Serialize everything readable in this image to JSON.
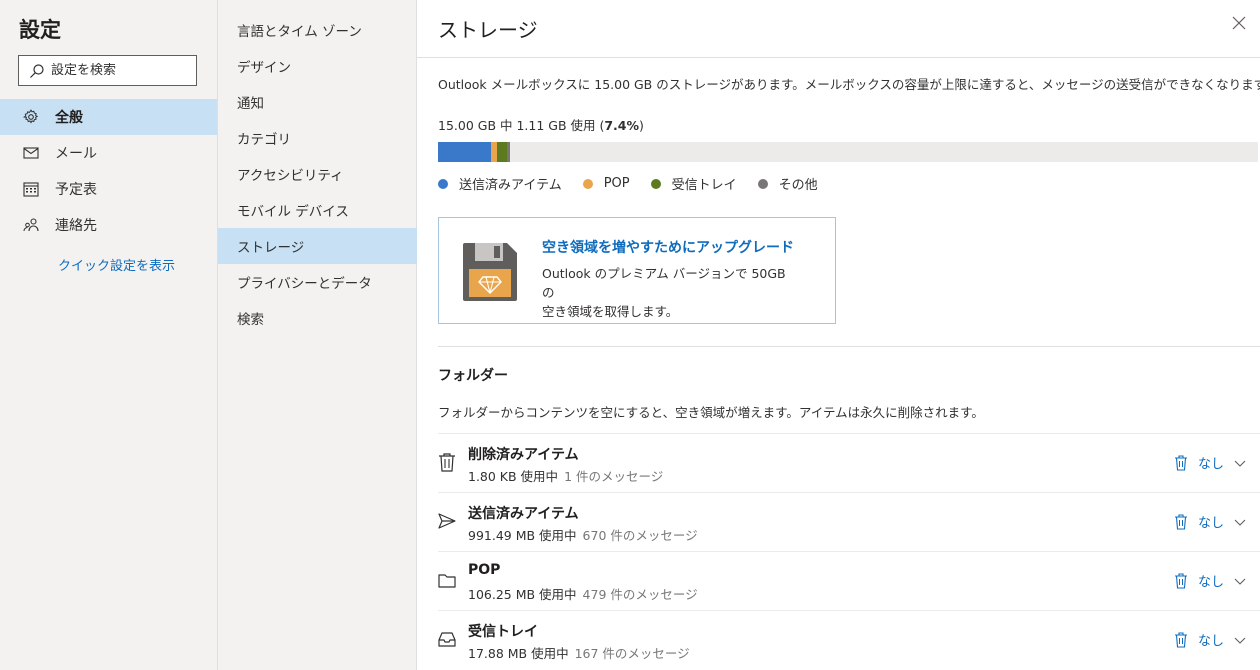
{
  "settings": {
    "title": "設定",
    "search_placeholder": "設定を検索",
    "nav": [
      {
        "label": "全般",
        "icon": "gear-icon",
        "selected": true
      },
      {
        "label": "メール",
        "icon": "mail-icon",
        "selected": false
      },
      {
        "label": "予定表",
        "icon": "calendar-icon",
        "selected": false
      },
      {
        "label": "連絡先",
        "icon": "people-icon",
        "selected": false
      }
    ],
    "quick_settings": "クイック設定を表示"
  },
  "subnav": [
    {
      "label": "言語とタイム ゾーン",
      "selected": false
    },
    {
      "label": "デザイン",
      "selected": false
    },
    {
      "label": "通知",
      "selected": false
    },
    {
      "label": "カテゴリ",
      "selected": false
    },
    {
      "label": "アクセシビリティ",
      "selected": false
    },
    {
      "label": "モバイル デバイス",
      "selected": false
    },
    {
      "label": "ストレージ",
      "selected": true
    },
    {
      "label": "プライバシーとデータ",
      "selected": false
    },
    {
      "label": "検索",
      "selected": false
    }
  ],
  "storage": {
    "title": "ストレージ",
    "description": "Outlook メールボックスに 15.00 GB のストレージがあります。メールボックスの容量が上限に達すると、メッセージの送受信ができなくなります。",
    "usage_text": "15.00 GB 中 1.11 GB 使用 (",
    "usage_percent": "7.4%",
    "usage_close": ")",
    "segments": [
      {
        "name": "送信済みアイテム",
        "color": "#3a78c9",
        "fraction": 0.0645
      },
      {
        "name": "POP",
        "color": "#e8a54b",
        "fraction": 0.0069
      },
      {
        "name": "受信トレイ",
        "color": "#5c7a1f",
        "fraction": 0.0116
      },
      {
        "name": "その他",
        "color": "#797775",
        "fraction": 0.004
      }
    ],
    "upgrade": {
      "title": "空き領域を増やすためにアップグレード",
      "line1": "Outlook のプレミアム バージョンで 50GB の",
      "line2": "空き領域を取得します。"
    }
  },
  "folders": {
    "title": "フォルダー",
    "description": "フォルダーからコンテンツを空にすると、空き領域が増えます。アイテムは永久に削除されます。",
    "items": [
      {
        "name": "削除済みアイテム",
        "size": "1.80 KB 使用中",
        "count": "1 件のメッセージ",
        "action": "なし",
        "icon": "trash"
      },
      {
        "name": "送信済みアイテム",
        "size": "991.49 MB 使用中",
        "count": "670 件のメッセージ",
        "action": "なし",
        "icon": "send"
      },
      {
        "name": "POP",
        "size": "106.25 MB 使用中",
        "count": "479 件のメッセージ",
        "action": "なし",
        "icon": "folder"
      },
      {
        "name": "受信トレイ",
        "size": "17.88 MB 使用中",
        "count": "167 件のメッセージ",
        "action": "なし",
        "icon": "inbox"
      }
    ]
  }
}
